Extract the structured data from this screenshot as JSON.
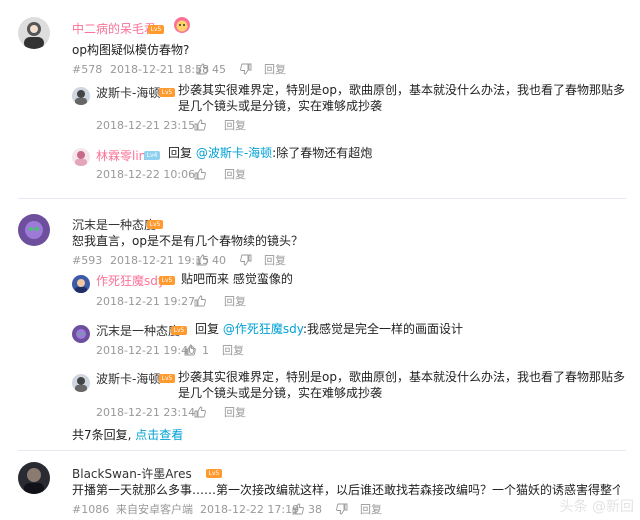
{
  "c1": {
    "username": "中二病的呆毛君",
    "level": "Lv5",
    "text": "op构图疑似模仿春物?",
    "floor": "#578",
    "time": "2018-12-21 18:58",
    "likes": "45",
    "reply_label": "回复",
    "replies": [
      {
        "username": "波斯卡-海顿",
        "level": "Lv5",
        "text": "抄袭其实很难界定，特别是op，歌曲原创，基本就没什么办法，我也看了春物那贴多是几个镜头或是分镜，实在难够成抄袭",
        "time": "2018-12-21 23:15",
        "reply_label": "回复"
      },
      {
        "username": "林霖零lin",
        "level": "Lv4",
        "prefix": "回复 ",
        "mention": "@波斯卡-海顿",
        "text": ":除了春物还有超炮",
        "time": "2018-12-22 10:06",
        "reply_label": "回复"
      }
    ]
  },
  "c2": {
    "username": "沉末是一种态度",
    "level": "Lv5",
    "text": "恕我直言，op是不是有几个春物续的镜头？",
    "floor": "#593",
    "time": "2018-12-21 19:15",
    "likes": "40",
    "reply_label": "回复",
    "replies": [
      {
        "username": "作死狂魔sdy",
        "level": "Lv5",
        "text": "贴吧而来 感觉蛮像的",
        "time": "2018-12-21 19:27",
        "reply_label": "回复"
      },
      {
        "username": "沉末是一种态度",
        "level": "Lv5",
        "prefix": "回复 ",
        "mention": "@作死狂魔sdy",
        "text": ":我感觉是完全一样的画面设计",
        "time": "2018-12-21 19:40",
        "likes": "1",
        "reply_label": "回复"
      },
      {
        "username": "波斯卡-海顿",
        "level": "Lv5",
        "text": "抄袭其实很难界定，特别是op，歌曲原创，基本就没什么办法，我也看了春物那贴多是几个镜头或是分镜，实在难够成抄袭",
        "time": "2018-12-21 23:14",
        "reply_label": "回复"
      }
    ],
    "more_prefix": "共7条回复, ",
    "more_link": "点击查看"
  },
  "c3": {
    "username": "BlackSwan-许墨Ares",
    "level": "Lv5",
    "text": "开播第一天就那么多事……第一次接改编就这样，以后谁还敢找若森接改编吗？一个猫妖的诱惑害得整个国漫都要被黑",
    "floor": "#1086",
    "source": "来自安卓客户端",
    "time": "2018-12-22 17:19",
    "likes": "38",
    "reply_label": "回复"
  },
  "watermark": "头条 @新回"
}
